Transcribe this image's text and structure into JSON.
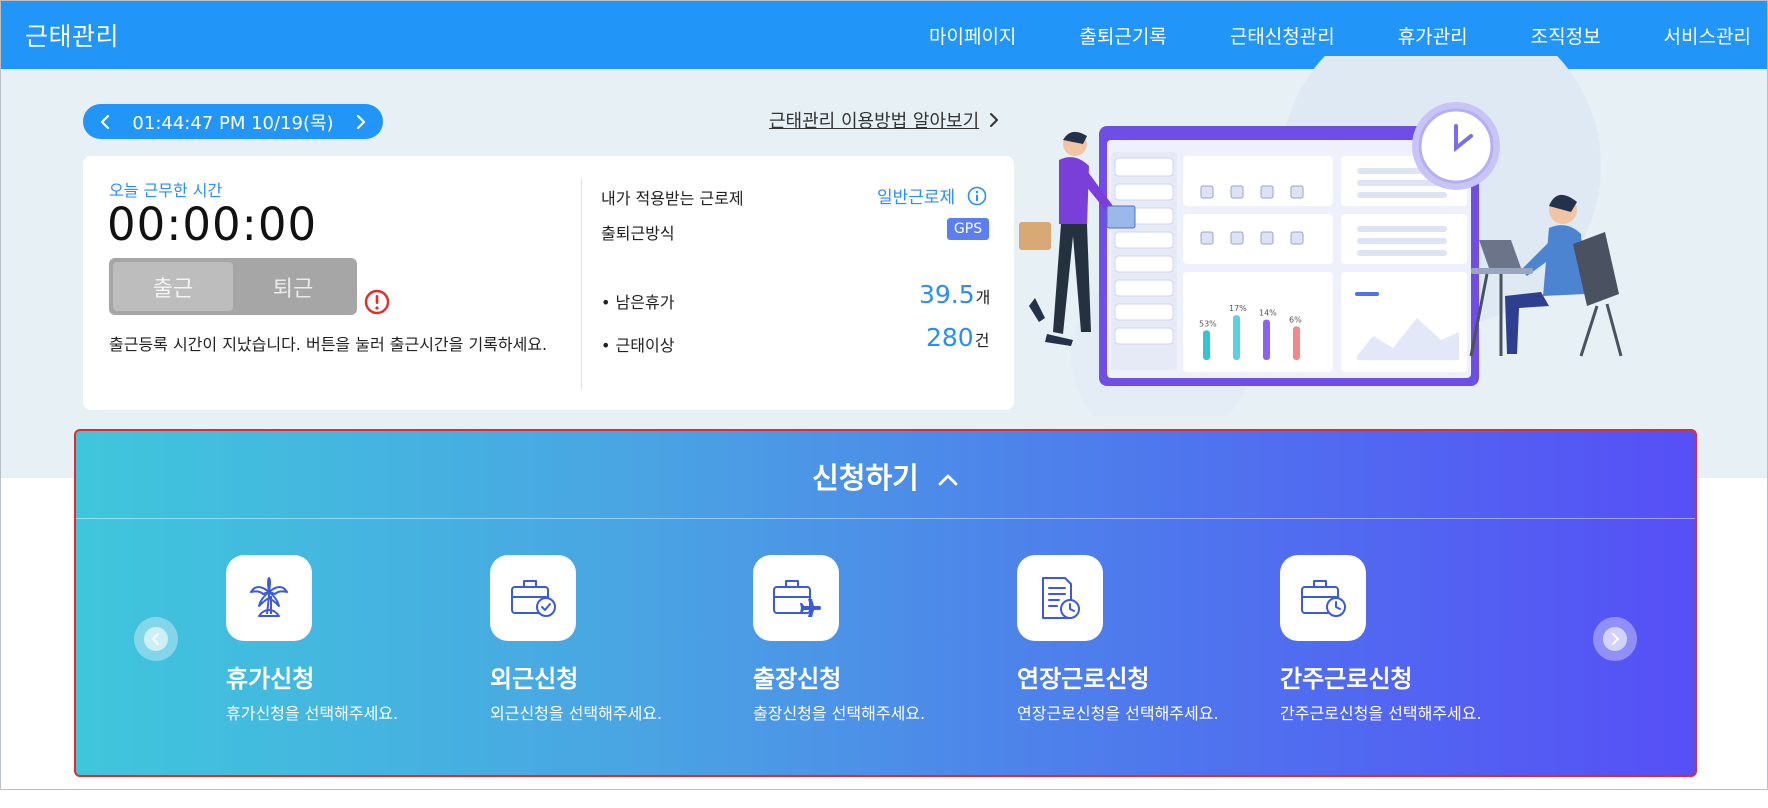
{
  "app": {
    "brand": "근태관리"
  },
  "nav": {
    "items": [
      "마이페이지",
      "출퇴근기록",
      "근태신청관리",
      "휴가관리",
      "조직정보",
      "서비스관리"
    ]
  },
  "clock": {
    "display": "01:44:47 PM 10/19(목)"
  },
  "guide": {
    "label": "근태관리 이용방법 알아보기"
  },
  "status": {
    "worked_label": "오늘 근무한 시간",
    "worked_time": "00:00:00",
    "checkin_label": "출근",
    "checkout_label": "퇴근",
    "notice": "출근등록 시간이 지났습니다. 버튼을 눌러 출근시간을 기록하세요.",
    "work_system_label": "내가 적용받는 근로제",
    "work_system_value": "일반근로제",
    "method_label": "출퇴근방식",
    "method_value": "GPS",
    "leave_label": "남은휴가",
    "leave_value": "39.5",
    "leave_unit": "개",
    "anomaly_label": "근태이상",
    "anomaly_value": "280",
    "anomaly_unit": "건"
  },
  "illustration": {
    "bars": [
      {
        "label": "53%",
        "value": 0.53,
        "color": "#34c4d6"
      },
      {
        "label": "17%",
        "value": 0.8,
        "color": "#5ad1e4"
      },
      {
        "label": "14%",
        "value": 0.72,
        "color": "#8a63ee"
      },
      {
        "label": "6%",
        "value": 0.6,
        "color": "#f08a8a"
      }
    ]
  },
  "requests": {
    "title": "신청하기",
    "items": [
      {
        "title": "휴가신청",
        "desc": "휴가신청을 선택해주세요.",
        "icon": "palm-tree-icon"
      },
      {
        "title": "외근신청",
        "desc": "외근신청을 선택해주세요.",
        "icon": "briefcase-check-icon"
      },
      {
        "title": "출장신청",
        "desc": "출장신청을 선택해주세요.",
        "icon": "briefcase-plane-icon"
      },
      {
        "title": "연장근로신청",
        "desc": "연장근로신청을 선택해주세요.",
        "icon": "document-clock-icon"
      },
      {
        "title": "간주근로신청",
        "desc": "간주근로신청을 선택해주세요.",
        "icon": "briefcase-clock-icon"
      }
    ]
  },
  "colors": {
    "primary": "#2196f8",
    "accent_text": "#2a8ff0",
    "warning": "#e22b2b",
    "gradient_start": "#3fc6dc",
    "gradient_end": "#564ff6"
  }
}
